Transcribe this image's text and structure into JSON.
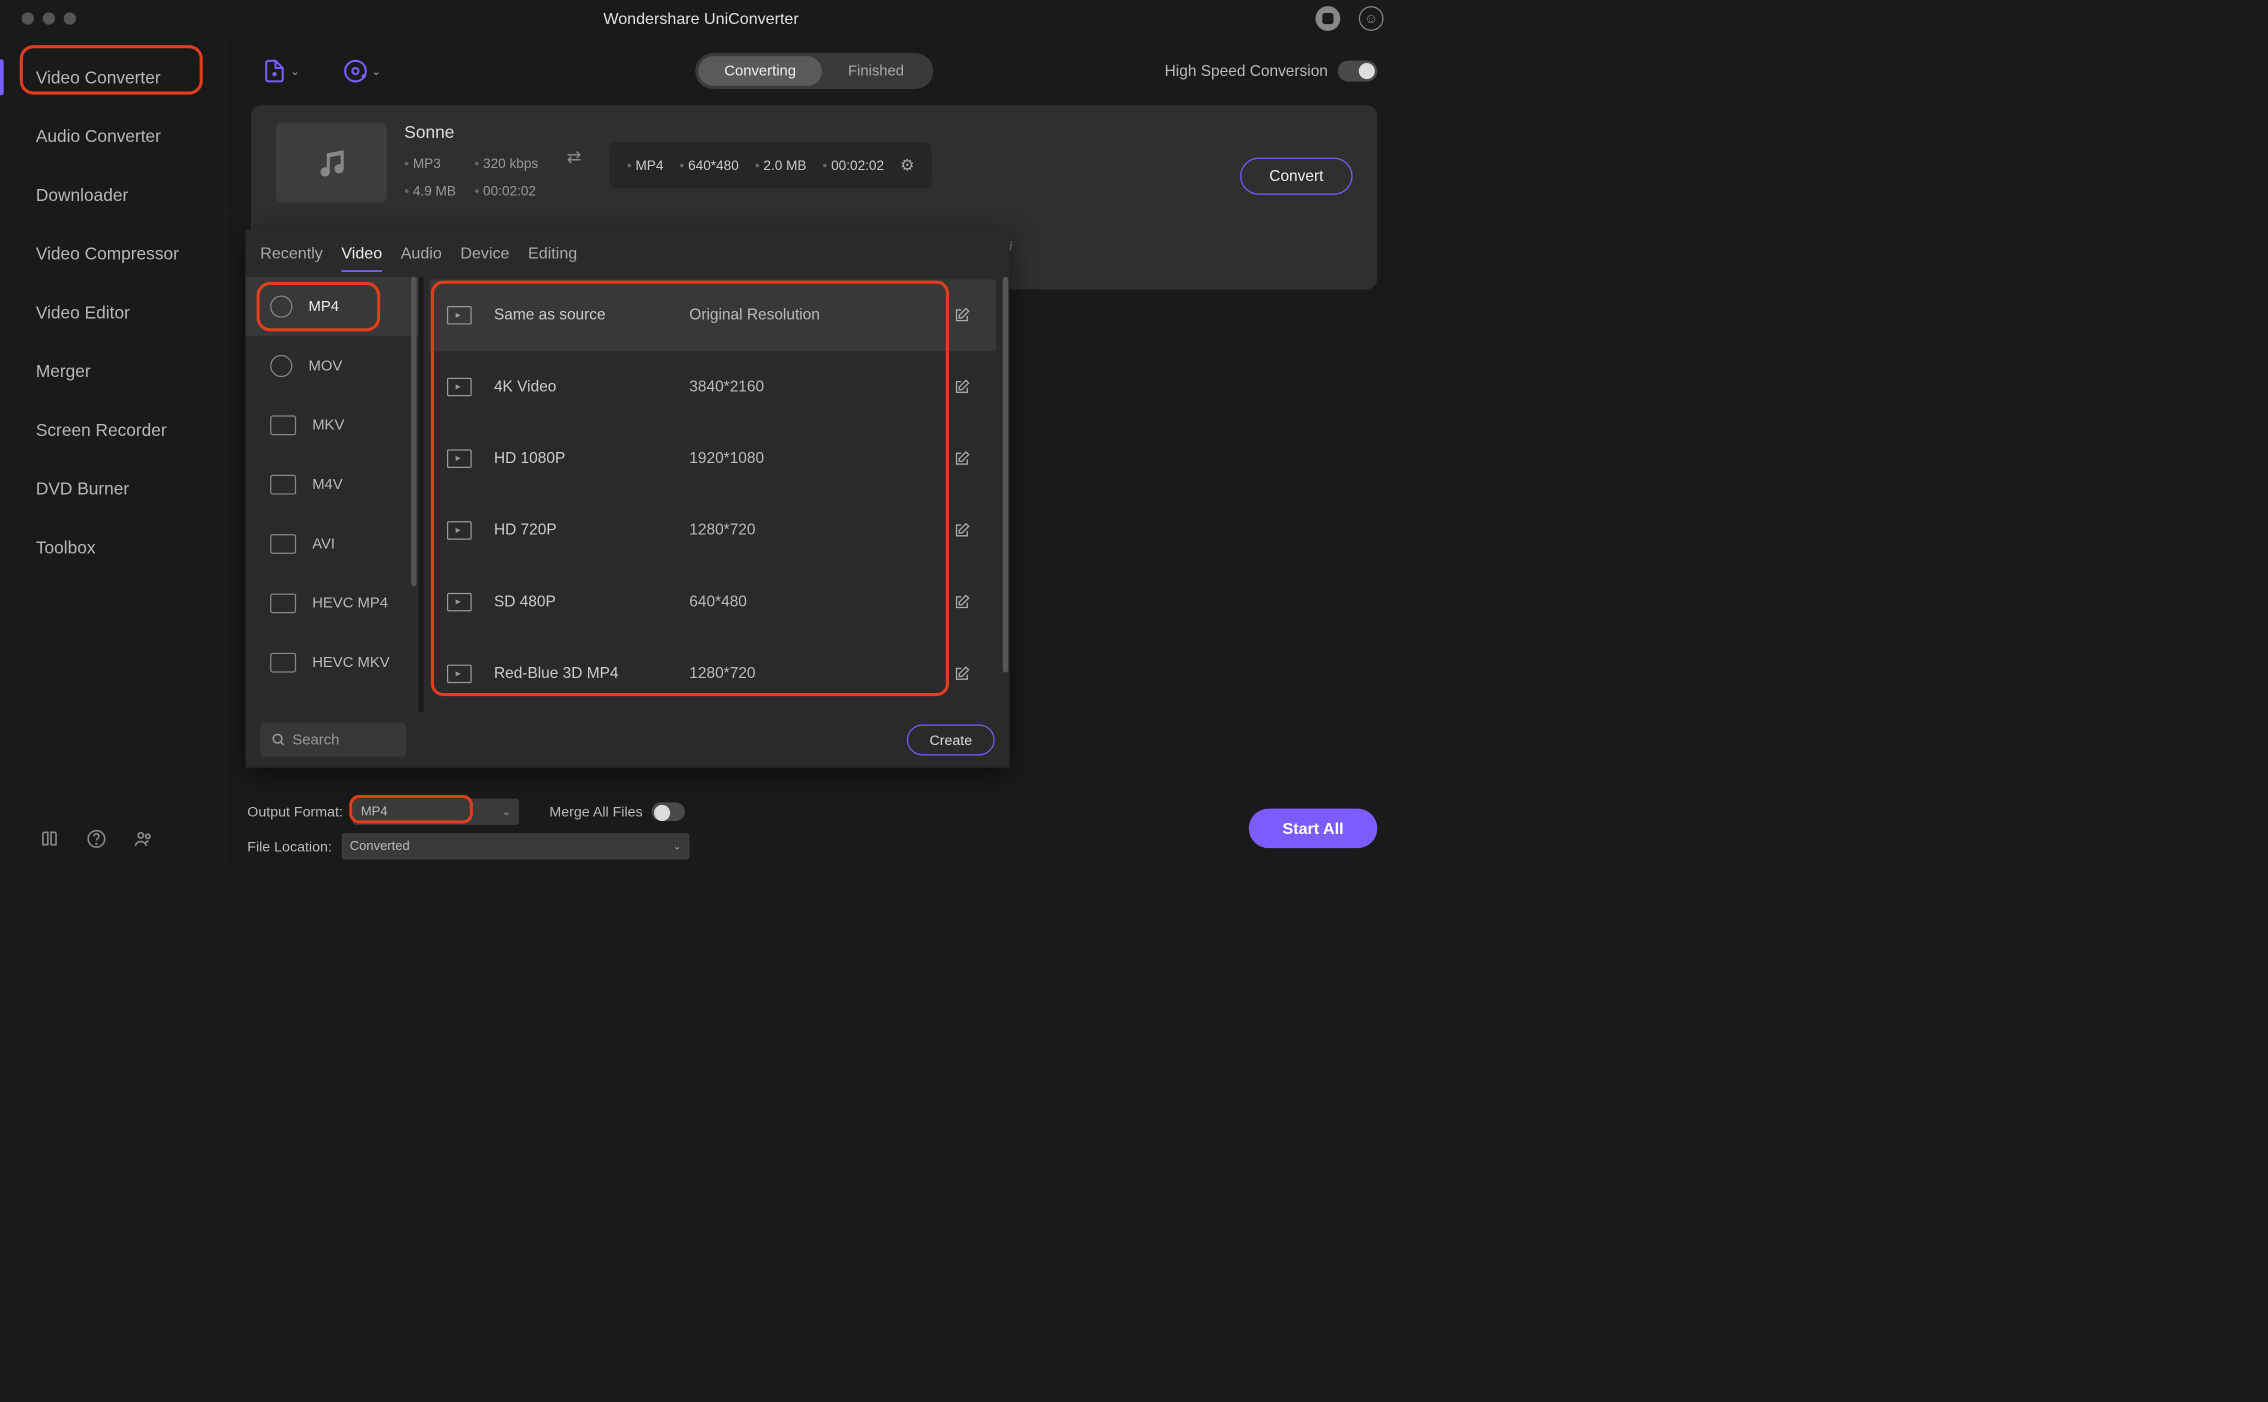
{
  "window_title": "Wondershare UniConverter",
  "sidebar": {
    "items": [
      {
        "label": "Video Converter",
        "active": true
      },
      {
        "label": "Audio Converter"
      },
      {
        "label": "Downloader"
      },
      {
        "label": "Video Compressor"
      },
      {
        "label": "Video Editor"
      },
      {
        "label": "Merger"
      },
      {
        "label": "Screen Recorder"
      },
      {
        "label": "DVD Burner"
      },
      {
        "label": "Toolbox"
      }
    ]
  },
  "toolbar": {
    "segment": {
      "converting": "Converting",
      "finished": "Finished"
    },
    "hispeed_label": "High Speed Conversion"
  },
  "file": {
    "title": "Sonne",
    "src": {
      "format": "MP3",
      "bitrate": "320 kbps",
      "size": "4.9 MB",
      "duration": "00:02:02"
    },
    "dst": {
      "format": "MP4",
      "resolution": "640*480",
      "size": "2.0 MB",
      "duration": "00:02:02"
    },
    "convert_label": "Convert"
  },
  "format_pop": {
    "tabs": [
      "Recently",
      "Video",
      "Audio",
      "Device",
      "Editing"
    ],
    "active_tab": 1,
    "formats": [
      "MP4",
      "MOV",
      "MKV",
      "M4V",
      "AVI",
      "HEVC MP4",
      "HEVC MKV"
    ],
    "active_format": 0,
    "presets": [
      {
        "name": "Same as source",
        "res": "Original Resolution"
      },
      {
        "name": "4K Video",
        "res": "3840*2160"
      },
      {
        "name": "HD 1080P",
        "res": "1920*1080"
      },
      {
        "name": "HD 720P",
        "res": "1280*720"
      },
      {
        "name": "SD 480P",
        "res": "640*480"
      },
      {
        "name": "Red-Blue 3D MP4",
        "res": "1280*720"
      }
    ],
    "search_placeholder": "Search",
    "create_label": "Create"
  },
  "bottom": {
    "output_format_label": "Output Format:",
    "output_format_value": "MP4",
    "file_location_label": "File Location:",
    "file_location_value": "Converted",
    "merge_label": "Merge All Files",
    "start_all_label": "Start All"
  }
}
